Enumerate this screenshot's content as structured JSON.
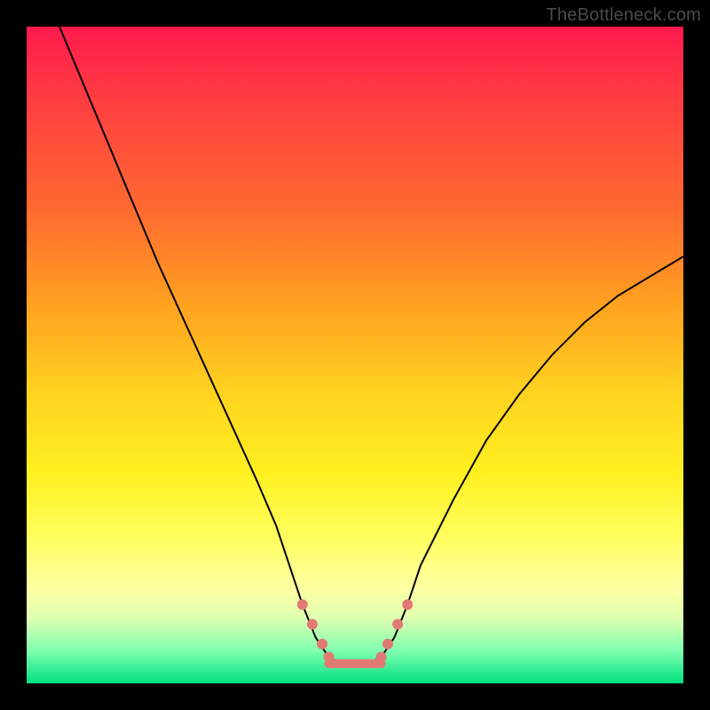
{
  "watermark": "TheBottleneck.com",
  "colors": {
    "frame": "#000000",
    "curve": "#000000",
    "marker": "#e27a74",
    "gradient_stops": [
      {
        "pct": 0,
        "hex": "#ff1a4d"
      },
      {
        "pct": 12,
        "hex": "#ff4040"
      },
      {
        "pct": 28,
        "hex": "#ff6a30"
      },
      {
        "pct": 42,
        "hex": "#ffa020"
      },
      {
        "pct": 55,
        "hex": "#ffd020"
      },
      {
        "pct": 68,
        "hex": "#fff020"
      },
      {
        "pct": 78,
        "hex": "#ffff60"
      },
      {
        "pct": 85,
        "hex": "#ffffa0"
      },
      {
        "pct": 90,
        "hex": "#e0ffb0"
      },
      {
        "pct": 95,
        "hex": "#80ffb0"
      },
      {
        "pct": 100,
        "hex": "#00e080"
      }
    ]
  },
  "chart_data": {
    "type": "line",
    "title": "",
    "xlabel": "",
    "ylabel": "",
    "xlim": [
      0,
      100
    ],
    "ylim": [
      0,
      100
    ],
    "grid": false,
    "legend": false,
    "series": [
      {
        "name": "bottleneck-curve",
        "x": [
          5,
          10,
          15,
          20,
          25,
          30,
          35,
          38,
          40,
          42,
          44,
          46,
          48,
          50,
          52,
          54,
          56,
          58,
          60,
          65,
          70,
          75,
          80,
          85,
          90,
          95,
          100
        ],
        "y": [
          100,
          88,
          76,
          64,
          53,
          42,
          31,
          24,
          18,
          12,
          7,
          4,
          3,
          3,
          3,
          4,
          7,
          12,
          18,
          28,
          37,
          44,
          50,
          55,
          59,
          62,
          65
        ]
      }
    ],
    "markers": {
      "name": "highlight-dots",
      "x": [
        42,
        43.5,
        45,
        46,
        54,
        55,
        56.5,
        58
      ],
      "y": [
        12,
        9,
        6,
        4,
        4,
        6,
        9,
        12
      ],
      "r": 6
    },
    "flat_bottom": {
      "x0": 46,
      "x1": 54,
      "y": 3
    }
  }
}
